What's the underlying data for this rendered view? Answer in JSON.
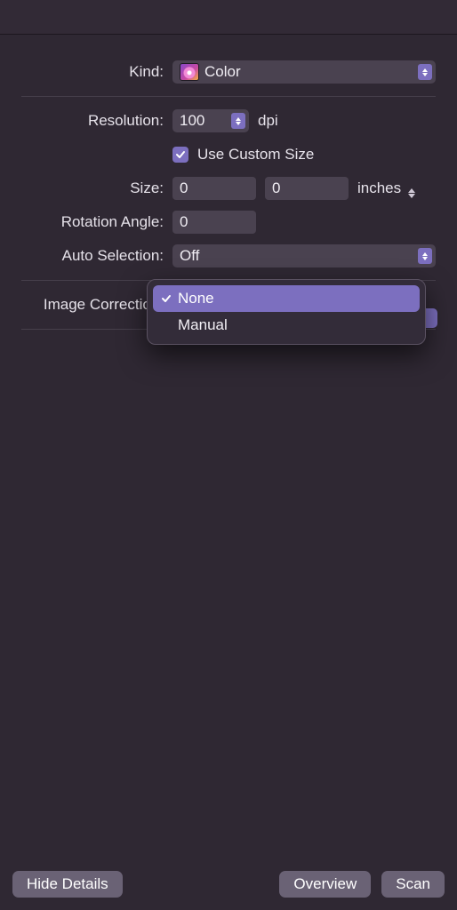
{
  "labels": {
    "kind": "Kind:",
    "resolution": "Resolution:",
    "useCustomSize": "Use Custom Size",
    "size": "Size:",
    "rotationAngle": "Rotation Angle:",
    "autoSelection": "Auto Selection:",
    "imageCorrection": "Image Correction:"
  },
  "values": {
    "kind": "Color",
    "resolution": "100",
    "resolutionUnit": "dpi",
    "sizeW": "0",
    "sizeH": "0",
    "sizeUnit": "inches",
    "rotationAngle": "0",
    "autoSelection": "Off",
    "useCustomSize": true
  },
  "dropdown": {
    "options": [
      {
        "label": "None",
        "selected": true
      },
      {
        "label": "Manual",
        "selected": false
      }
    ]
  },
  "footer": {
    "hideDetails": "Hide Details",
    "overview": "Overview",
    "scan": "Scan"
  }
}
